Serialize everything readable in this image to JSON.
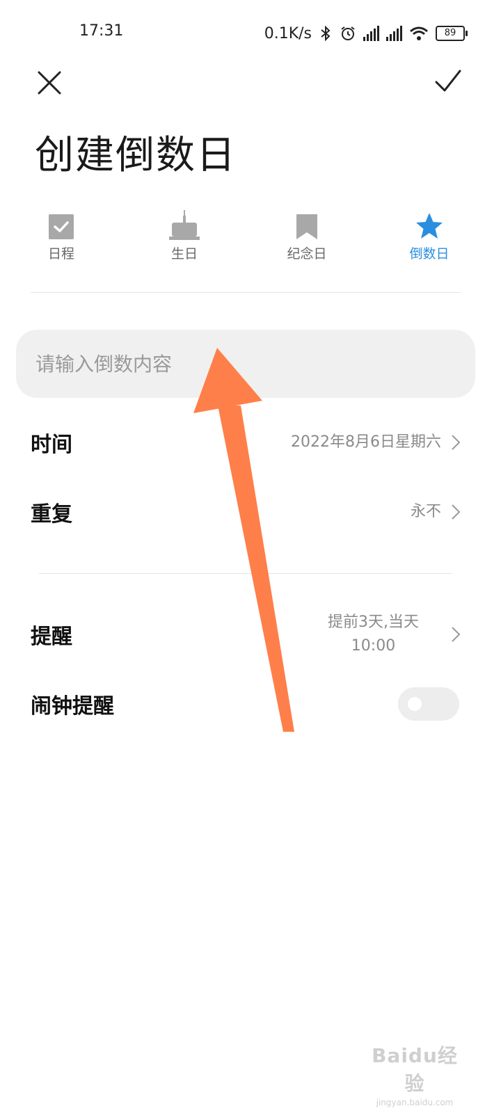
{
  "status_bar": {
    "time": "17:31",
    "net_speed": "0.1K/s",
    "battery": "89",
    "icons": [
      "bluetooth-icon",
      "alarm-icon",
      "signal-hd-icon",
      "signal-hd-icon",
      "wifi-icon",
      "battery-icon"
    ]
  },
  "page": {
    "title": "创建倒数日"
  },
  "tabs": [
    {
      "label": "日程",
      "icon": "checkbox-icon",
      "active": false
    },
    {
      "label": "生日",
      "icon": "cake-icon",
      "active": false
    },
    {
      "label": "纪念日",
      "icon": "bookmark-icon",
      "active": false
    },
    {
      "label": "倒数日",
      "icon": "star-icon",
      "active": true
    }
  ],
  "content_input": {
    "placeholder": "请输入倒数内容",
    "value": ""
  },
  "rows": {
    "time": {
      "label": "时间",
      "value": "2022年8月6日星期六"
    },
    "repeat": {
      "label": "重复",
      "value": "永不"
    },
    "reminder": {
      "label": "提醒",
      "value_line1": "提前3天,当天",
      "value_line2": "10:00"
    },
    "alarm": {
      "label": "闹钟提醒",
      "enabled": false
    }
  },
  "watermark": {
    "logo": "Baidu经验",
    "url": "jingyan.baidu.com"
  },
  "colors": {
    "accent": "#2a8ee0",
    "arrow": "#ff7f4a",
    "inactive_icon": "#a8a8a8"
  }
}
